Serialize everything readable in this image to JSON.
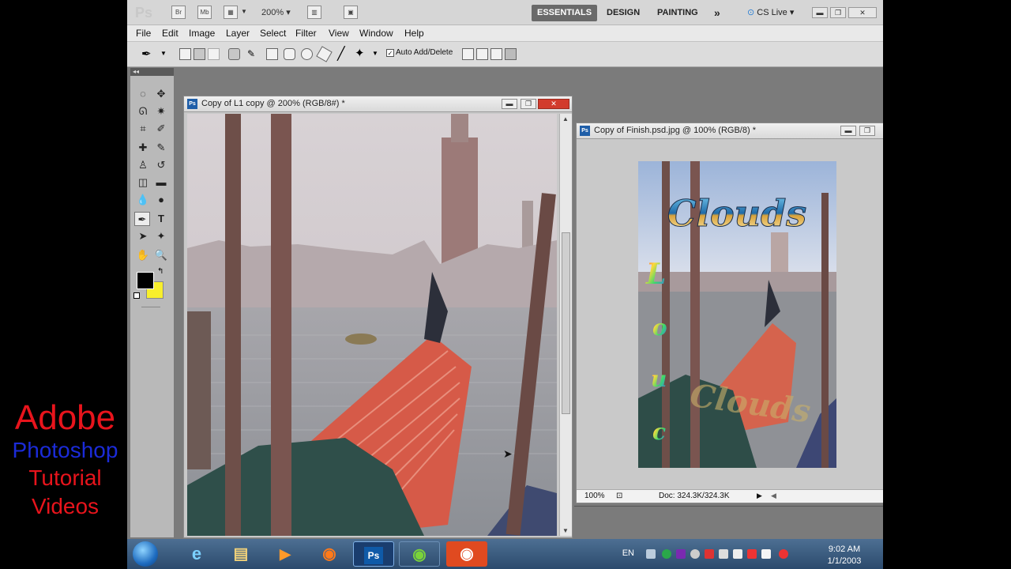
{
  "overlay": {
    "line1": "Adobe",
    "line2": "Photoshop",
    "line3": "Tutorial",
    "line4": "Videos"
  },
  "appbar": {
    "logo": "Ps",
    "bridge": "Br",
    "minibridge": "Mb",
    "zoom": "200%",
    "workspaces": [
      "ESSENTIALS",
      "DESIGN",
      "PAINTING"
    ],
    "more": "»",
    "cslive": "CS Live"
  },
  "menu": [
    "File",
    "Edit",
    "Image",
    "Layer",
    "Select",
    "Filter",
    "View",
    "Window",
    "Help"
  ],
  "options": {
    "auto_add_delete": "Auto Add/Delete"
  },
  "doc1": {
    "title": "Copy of L1 copy @ 200% (RGB/8#) *"
  },
  "doc2": {
    "title": "Copy of Finish.psd.jpg @ 100% (RGB/8) *",
    "zoom": "100%",
    "docsize": "Doc: 324.3K/324.3K"
  },
  "artwork": {
    "headline": "Clouds",
    "letters": [
      "L",
      "o",
      "u",
      "c"
    ],
    "reflection": "Clouds"
  },
  "tray": {
    "lang": "EN",
    "time": "9:02 AM",
    "date": "1/1/2003"
  },
  "colors": {
    "foreground": "#000000",
    "background": "#f8ef2c"
  }
}
